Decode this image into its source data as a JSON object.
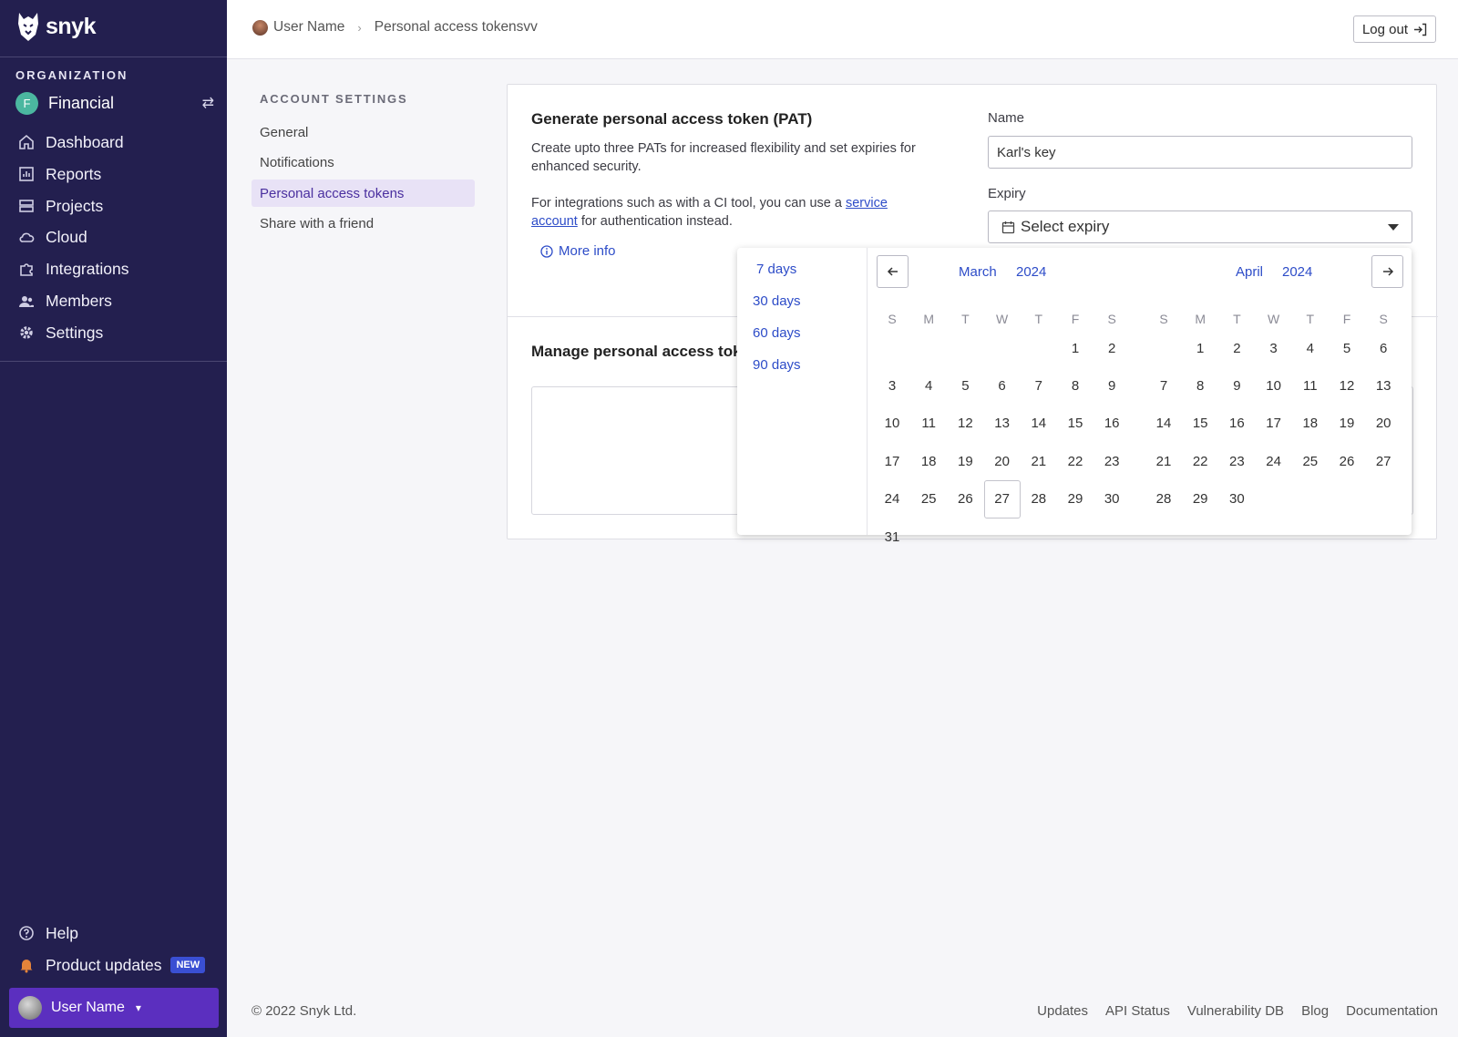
{
  "brand": {
    "name": "snyk"
  },
  "sidebar": {
    "org_label": "ORGANIZATION",
    "org_initial": "F",
    "org_name": "Financial",
    "items": [
      {
        "label": "Dashboard",
        "icon": "home-icon"
      },
      {
        "label": "Reports",
        "icon": "chart-icon"
      },
      {
        "label": "Projects",
        "icon": "projects-icon"
      },
      {
        "label": "Cloud",
        "icon": "cloud-icon"
      },
      {
        "label": "Integrations",
        "icon": "puzzle-icon"
      },
      {
        "label": "Members",
        "icon": "members-icon"
      },
      {
        "label": "Settings",
        "icon": "gear-icon"
      }
    ],
    "help": "Help",
    "product_updates": "Product updates",
    "new_badge": "NEW",
    "user_name": "User Name"
  },
  "header": {
    "breadcrumb_user": "User Name",
    "breadcrumb_page": "Personal access tokensvv",
    "logout": "Log out"
  },
  "settings_nav": {
    "label": "ACCOUNT SETTINGS",
    "items": [
      "General",
      "Notifications",
      "Personal access tokens",
      "Share with a friend"
    ],
    "active": "Personal access tokens"
  },
  "generate": {
    "title": "Generate personal access token (PAT)",
    "description": "Create upto three PATs for increased flexibility and set expiries for enhanced security.",
    "note_prefix": "For integrations such as with a CI tool, you can use a ",
    "note_link": "service account",
    "note_suffix": " for authentication instead.",
    "more_info": "More info",
    "name_label": "Name",
    "name_value": "Karl's key",
    "expiry_label": "Expiry",
    "expiry_placeholder": "Select expiry"
  },
  "manage": {
    "title": "Manage personal access tok"
  },
  "date_picker": {
    "presets": [
      "7 days",
      "30 days",
      "60 days",
      "90 days"
    ],
    "weekdays": [
      "S",
      "M",
      "T",
      "W",
      "T",
      "F",
      "S"
    ],
    "months": [
      {
        "month": "March",
        "year": "2024",
        "first_weekday": 5,
        "days": 31,
        "highlighted": 27
      },
      {
        "month": "April",
        "year": "2024",
        "first_weekday": 1,
        "days": 30
      }
    ]
  },
  "footer": {
    "copyright": "© 2022 Snyk Ltd.",
    "links": [
      "Updates",
      "API Status",
      "Vulnerability DB",
      "Blog",
      "Documentation"
    ]
  },
  "colors": {
    "sidebar_bg": "#231f4f",
    "accent_link": "#2d4cc8",
    "active_nav_bg": "#e8e2f6",
    "user_bar": "#5b2fbf"
  }
}
